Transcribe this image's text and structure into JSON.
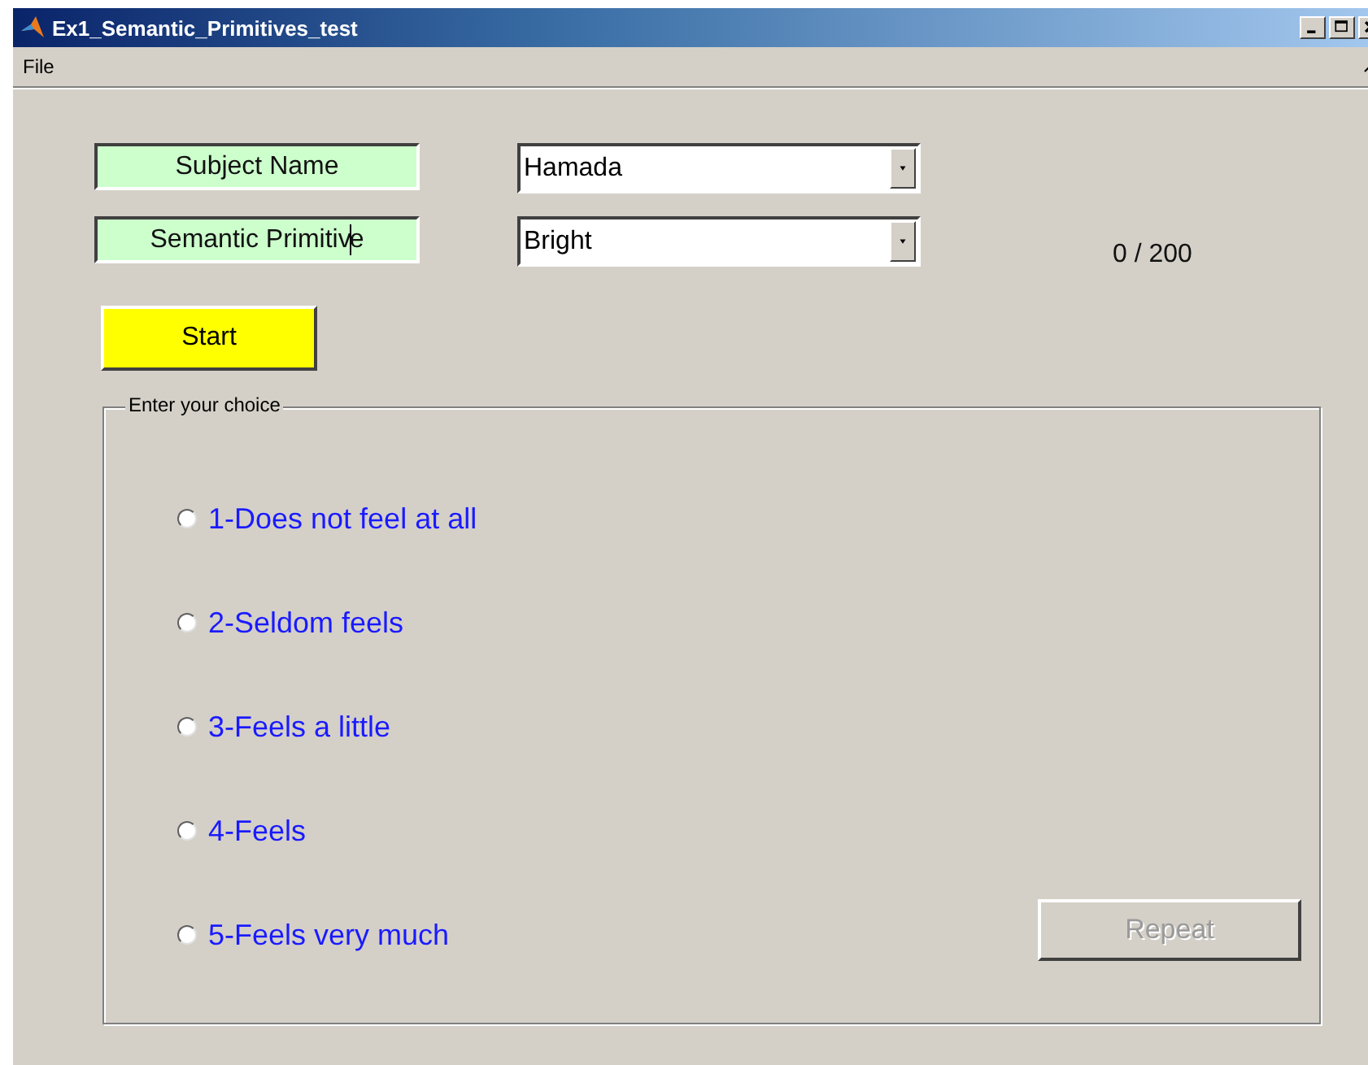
{
  "window": {
    "title": "Ex1_Semantic_Primitives_test"
  },
  "menu": [
    "File"
  ],
  "labels": [
    {
      "text": "Subject Name",
      "cursor": false
    },
    {
      "text": "Semantic Primitive",
      "cursor": true
    }
  ],
  "dropdowns": [
    {
      "value": "Hamada"
    },
    {
      "value": "Bright"
    }
  ],
  "start_button": {
    "label": "Start"
  },
  "counter": "0 / 200",
  "choice_panel": {
    "title": "Enter your choice",
    "options": [
      {
        "label": "1-Does not feel at all",
        "selected": false
      },
      {
        "label": "2-Seldom feels",
        "selected": false
      },
      {
        "label": "3-Feels a little",
        "selected": false
      },
      {
        "label": "4-Feels",
        "selected": false
      },
      {
        "label": "5-Feels very much",
        "selected": false
      }
    ],
    "repeat_button": {
      "label": "Repeat",
      "disabled": true
    }
  }
}
